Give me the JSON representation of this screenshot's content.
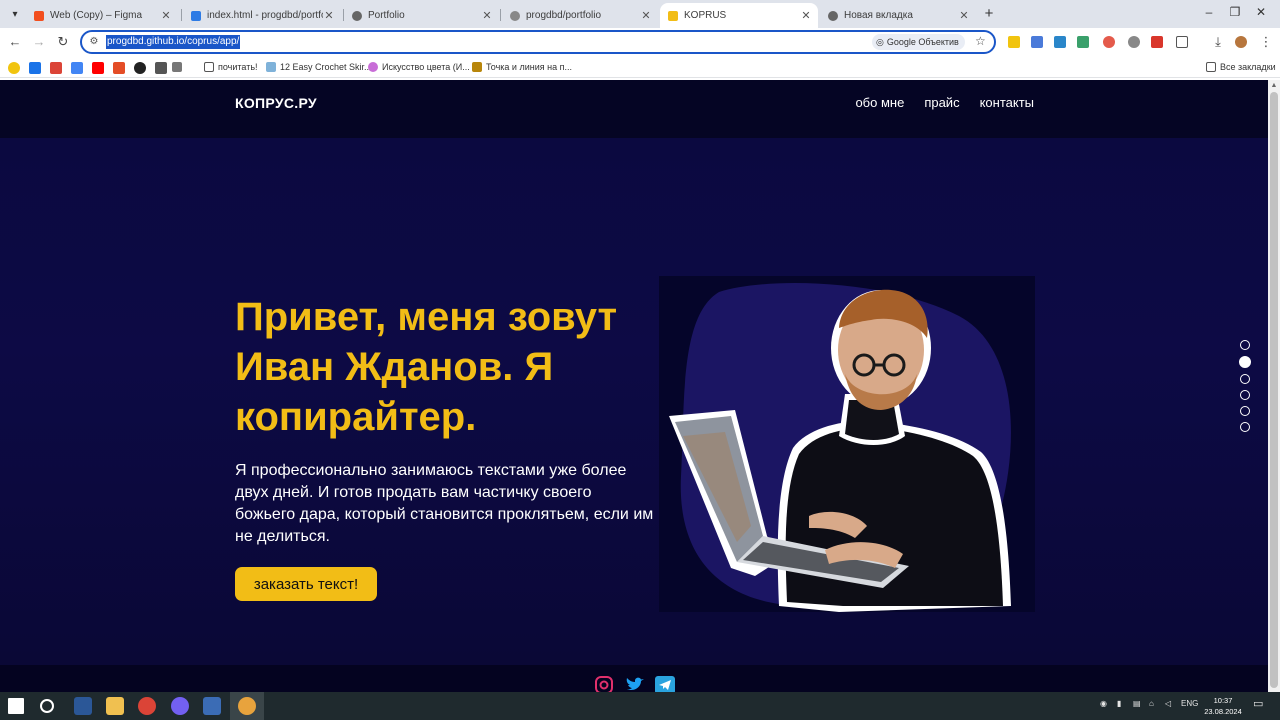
{
  "browser": {
    "tabs": [
      {
        "title": "Web (Copy) – Figma",
        "active": false
      },
      {
        "title": "index.html - progdbd/portfolio",
        "active": false
      },
      {
        "title": "Portfolio",
        "active": false
      },
      {
        "title": "progdbd/portfolio",
        "active": false
      },
      {
        "title": "KOPRUS",
        "active": true
      },
      {
        "title": "Новая вкладка",
        "active": false
      }
    ],
    "url": "progdbd.github.io/coprus/app/",
    "translate_chip": "Google Объектив",
    "bookmarks": [
      {
        "label": ""
      },
      {
        "label": "почитать!"
      },
      {
        "label": "12 Easy Crochet Skir..."
      },
      {
        "label": "Искусство цвета (И..."
      },
      {
        "label": "Точка и линия на п..."
      }
    ],
    "all_bookmarks": "Все закладки"
  },
  "site": {
    "logo": "КОПРУС.РУ",
    "nav": [
      "обо мне",
      "прайс",
      "контакты"
    ],
    "hero": {
      "title": "Привет, меня зовут Иван Жданов. Я копирайтер.",
      "text": "Я профессионально занимаюсь текстами уже более двух дней. И готов продать вам частичку своего божьего дара, который становится проклятьем, если им не делиться.",
      "cta": "заказать текст!"
    },
    "slider_dots": 6,
    "active_dot": 1,
    "social": [
      "instagram-icon",
      "twitter-icon",
      "telegram-icon"
    ],
    "colors": {
      "accent": "#f2bd16",
      "background": "#0b0940",
      "blob": "#1b1563"
    }
  },
  "taskbar": {
    "lang": "ENG",
    "time": "10:37",
    "date": "23.08.2024"
  }
}
